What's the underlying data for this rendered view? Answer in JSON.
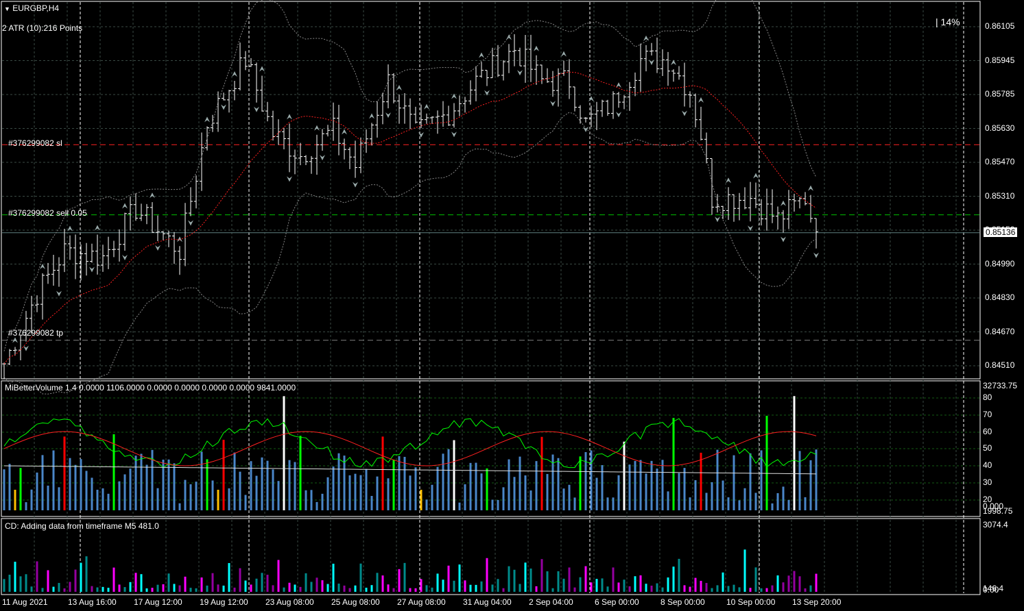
{
  "header": {
    "symbol": "EURGBP,H4",
    "atr_label": "2 ATR (10):216 Points",
    "spread_pct": "14%"
  },
  "price_axis": {
    "labels": [
      "0.86105",
      "0.85945",
      "0.85785",
      "0.85630",
      "0.85470",
      "0.85310",
      "0.85150",
      "0.84990",
      "0.84830",
      "0.84670",
      "0.84510"
    ],
    "max": 0.86105,
    "min": 0.8451,
    "current": "0.85136"
  },
  "orders": {
    "sl_label": "#376299082 sl",
    "sl_price": 0.8555,
    "sell_label": "#376299082 sell 0.05",
    "sell_price": 0.8522,
    "tp_label": "#376299082 tp",
    "tp_price": 0.8463,
    "bid": 0.85136
  },
  "price_path": [
    [
      0,
      0.8452
    ],
    [
      6,
      0.8485
    ],
    [
      11,
      0.8505
    ],
    [
      18,
      0.8502
    ],
    [
      24,
      0.8525
    ],
    [
      32,
      0.8505
    ],
    [
      37,
      0.8565
    ],
    [
      44,
      0.8595
    ],
    [
      49,
      0.856
    ],
    [
      54,
      0.855
    ],
    [
      60,
      0.8562
    ],
    [
      64,
      0.8545
    ],
    [
      70,
      0.8585
    ],
    [
      75,
      0.856
    ],
    [
      81,
      0.857
    ],
    [
      86,
      0.8585
    ],
    [
      93,
      0.86
    ],
    [
      98,
      0.8585
    ],
    [
      103,
      0.8585
    ],
    [
      106,
      0.8565
    ],
    [
      111,
      0.8575
    ],
    [
      116,
      0.8595
    ],
    [
      121,
      0.8595
    ],
    [
      125,
      0.858
    ],
    [
      127,
      0.856
    ],
    [
      129,
      0.853
    ],
    [
      136,
      0.853
    ],
    [
      141,
      0.852
    ],
    [
      146,
      0.853
    ],
    [
      148,
      0.8514
    ]
  ],
  "volume_panel": {
    "title": "MiBetterVolume 1.4 0.0000 1106.0000 0.0000 0.0000 0.0000 0.0000 9841.0000",
    "labels": [
      "32733.75",
      "80",
      "70",
      "60",
      "50",
      "40",
      "30",
      "20",
      "0.000",
      "1998.75"
    ],
    "colors": {
      "normal": "#4a86c8",
      "climax": "#ff0000",
      "high": "#00ff00",
      "churn": "#ffffff",
      "low": "#ffc000"
    }
  },
  "cd_panel": {
    "title": "CD: Adding data from timeframe M5  481.0",
    "labels": [
      "3074.4",
      "146.4",
      "0.00"
    ],
    "colors": {
      "a": "#008b8b",
      "b": "#9400a0",
      "c": "#00ffff",
      "d": "#ff00ff"
    }
  },
  "time_axis": [
    "11 Aug 2021",
    "13 Aug 16:00",
    "17 Aug 12:00",
    "19 Aug 12:00",
    "23 Aug 08:00",
    "25 Aug 08:00",
    "27 Aug 08:00",
    "31 Aug 04:00",
    "2 Sep 04:00",
    "6 Sep 00:00",
    "8 Sep 00:00",
    "10 Sep 00:00",
    "13 Sep 20:00"
  ]
}
